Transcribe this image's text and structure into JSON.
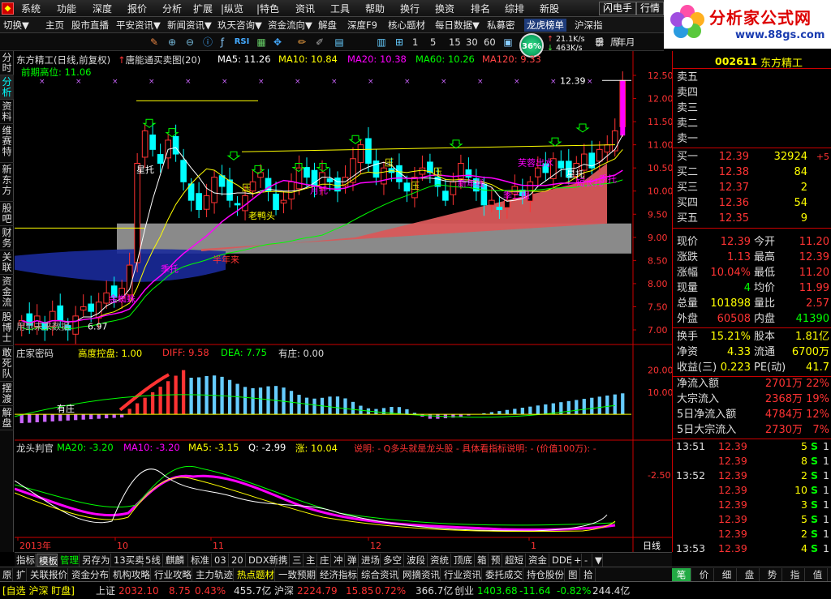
{
  "menubar": {
    "items": [
      "系统",
      "功能",
      "深度",
      "报价",
      "分析",
      "扩展",
      "|纵览",
      "|特色",
      "资讯",
      "工具",
      "帮助",
      "换行",
      "换资",
      "排名",
      "综排",
      "新股"
    ],
    "right_buttons": [
      "闪电手",
      "行情"
    ]
  },
  "logo": {
    "title": "分析家公式网",
    "url_text": "www.88gs.com"
  },
  "toolbar": {
    "items": [
      "切换▼",
      "主页",
      "股市直播",
      "平安资讯▼",
      "新闻资讯▼",
      "玖天咨询▼",
      "资金流向▼",
      "解盘",
      "深度F9",
      "核心题材",
      "每日数据▼",
      "私募密",
      "龙虎榜单",
      "沪深指"
    ]
  },
  "toolbar2": {
    "icons": [
      "pen-icon",
      "zoom-in-icon",
      "zoom-out-icon",
      "info-icon",
      "fx-icon",
      "rsi-icon",
      "grid-icon",
      "move-icon",
      "pencil-icon",
      "edit-icon",
      "chart-mini-icon"
    ],
    "rsi_label": "RSI",
    "periods": [
      "1",
      "5",
      "15",
      "30",
      "60"
    ],
    "gauge": "36%",
    "net_up": "21.1K/s",
    "net_down": "463K/s",
    "period_labels": [
      "日",
      "周",
      "月",
      "季",
      "年"
    ]
  },
  "left_tabs": [
    "分时",
    "分析",
    "资料",
    "维赛特",
    "新东方",
    "股吧",
    "财务",
    "关联",
    "资金流",
    "股博士",
    "敢死队",
    "摆渡",
    "解盘"
  ],
  "chart": {
    "main_header": {
      "title": "东方精工(日线,前复权)",
      "indicator": "唐能通买卖图(20)",
      "ma5": "MA5: 11.26",
      "ma10": "MA10: 10.84",
      "ma20": "MA20: 10.38",
      "ma60": "MA60: 10.26",
      "ma120": "MA120: 9.33",
      "prev_high": "前期高位: 11.06"
    },
    "price_axis": [
      "12.50",
      "12.00",
      "11.50",
      "11.00",
      "10.50",
      "10.00",
      "9.50",
      "9.00",
      "8.50",
      "8.00",
      "7.50",
      "7.00"
    ],
    "annotations": {
      "high_value": "12.39",
      "low_value": "6.97",
      "future_data": "用到未来数据",
      "labels": [
        "星托",
        "压",
        "压",
        "月托",
        "老鸭头",
        "季托",
        "半年来",
        "金蜘蛛",
        "压",
        "新年线",
        "芙蓉出水",
        "星托",
        "短长托",
        "季三组",
        "季托",
        "压"
      ]
    },
    "ind1_header": {
      "name": "庄家密码",
      "control": "高度控盘: 1.00",
      "diff": "DIFF: 9.58",
      "dea": "DEA: 7.75",
      "zhuang": "有庄: 0.00"
    },
    "ind1_axis": [
      "20.00",
      "10.00"
    ],
    "ind1_label": "有庄",
    "ind2_header": {
      "name": "龙头判官",
      "ma20": "MA20: -3.20",
      "ma10": "MA10: -3.20",
      "ma5": "MA5: -3.15",
      "q": "Q: -2.99",
      "zhang": "涨: 10.04",
      "note": "说明: - Q多头就是龙头股 - 具体看指标说明: - (价值100万): -"
    },
    "ind2_axis": [
      "-2.50"
    ],
    "date_axis": [
      "2013年",
      "10",
      "11",
      "12",
      "1"
    ],
    "period": "日线"
  },
  "quote": {
    "code": "002611",
    "name": "东方精工",
    "sell": [
      {
        "label": "卖五",
        "price": "",
        "vol": "",
        "chg": ""
      },
      {
        "label": "卖四",
        "price": "",
        "vol": "",
        "chg": ""
      },
      {
        "label": "卖三",
        "price": "",
        "vol": "",
        "chg": ""
      },
      {
        "label": "卖二",
        "price": "",
        "vol": "",
        "chg": ""
      },
      {
        "label": "卖一",
        "price": "",
        "vol": "",
        "chg": ""
      }
    ],
    "buy": [
      {
        "label": "买一",
        "price": "12.39",
        "vol": "32924",
        "chg": "+5"
      },
      {
        "label": "买二",
        "price": "12.38",
        "vol": "84",
        "chg": ""
      },
      {
        "label": "买三",
        "price": "12.37",
        "vol": "2",
        "chg": ""
      },
      {
        "label": "买四",
        "price": "12.36",
        "vol": "54",
        "chg": ""
      },
      {
        "label": "买五",
        "price": "12.35",
        "vol": "9",
        "chg": ""
      }
    ],
    "stats": [
      {
        "l1": "现价",
        "v1": "12.39",
        "l2": "今开",
        "v2": "11.20",
        "c1": "red",
        "c2": "red"
      },
      {
        "l1": "涨跌",
        "v1": "1.13",
        "l2": "最高",
        "v2": "12.39",
        "c1": "red",
        "c2": "red"
      },
      {
        "l1": "涨幅",
        "v1": "10.04%",
        "l2": "最低",
        "v2": "11.20",
        "c1": "red",
        "c2": "red"
      },
      {
        "l1": "现量",
        "v1": "4",
        "l2": "均价",
        "v2": "11.99",
        "c1": "green",
        "c2": "red"
      },
      {
        "l1": "总量",
        "v1": "101898",
        "l2": "量比",
        "v2": "2.57",
        "c1": "yellow",
        "c2": "red"
      },
      {
        "l1": "外盘",
        "v1": "60508",
        "l2": "内盘",
        "v2": "41390",
        "c1": "red",
        "c2": "green"
      }
    ],
    "stats2": [
      {
        "l1": "换手",
        "v1": "15.21%",
        "l2": "股本",
        "v2": "1.81亿"
      },
      {
        "l1": "净资",
        "v1": "4.33",
        "l2": "流通",
        "v2": "6700万"
      },
      {
        "l1": "收益(三)",
        "v1": "0.223",
        "l2": "PE(动)",
        "v2": "41.7"
      }
    ],
    "flows": [
      {
        "l": "净流入额",
        "v": "2701万",
        "pc": "22%"
      },
      {
        "l": "大宗流入",
        "v": "2368万",
        "pc": "19%"
      },
      {
        "l": "5日净流入额",
        "v": "4784万",
        "pc": "12%"
      },
      {
        "l": "5日大宗流入",
        "v": "2730万",
        "pc": "7%"
      }
    ],
    "ticks": [
      {
        "t": "13:51",
        "p": "12.39",
        "v": "5",
        "s": "S",
        "n": "1"
      },
      {
        "t": "",
        "p": "12.39",
        "v": "8",
        "s": "S",
        "n": "1"
      },
      {
        "t": "13:52",
        "p": "12.39",
        "v": "2",
        "s": "S",
        "n": "1"
      },
      {
        "t": "",
        "p": "12.39",
        "v": "10",
        "s": "S",
        "n": "1"
      },
      {
        "t": "",
        "p": "12.39",
        "v": "3",
        "s": "S",
        "n": "1"
      },
      {
        "t": "",
        "p": "12.39",
        "v": "5",
        "s": "S",
        "n": "1"
      },
      {
        "t": "",
        "p": "12.39",
        "v": "2",
        "s": "S",
        "n": "1"
      },
      {
        "t": "13:53",
        "p": "12.39",
        "v": "4",
        "s": "S",
        "n": "1"
      }
    ]
  },
  "indicator_tabs": [
    "指标",
    "模板",
    "管理",
    "另存为",
    "13买卖",
    "5线",
    "麒麟",
    "标准",
    "03",
    "20",
    "DDX新",
    "携",
    "三",
    "主",
    "庄",
    "冲",
    "弹",
    "进场",
    "多空",
    "波段",
    "资统",
    "顶底",
    "箱",
    "预",
    "超短",
    "资金",
    "DDE",
    "+",
    "-",
    "▼"
  ],
  "right_tabs": [
    "笔",
    "价",
    "细",
    "盘",
    "势",
    "指",
    "值"
  ],
  "news_tabs": [
    "原",
    "扩",
    "关联报价",
    "资金分布",
    "机构攻略",
    "行业攻略",
    "主力轨迹",
    "热点题材",
    "一致预期",
    "经济指标",
    "综合资讯",
    "网摘资讯",
    "行业资讯",
    "委托成交",
    "持仓股份",
    "图",
    "拾"
  ],
  "status": {
    "market": "[自选 沪深 盯盘]",
    "sh_name": "上证",
    "sh_val": "2032.10",
    "sh_chg": "8.75",
    "sh_pct": "0.43%",
    "sh_amt": "455.7亿",
    "hs_name": "沪深",
    "hs_val": "2224.79",
    "hs_chg": "15.85",
    "hs_pct": "0.72%",
    "hs_amt": "366.7亿",
    "cy_name": "创业",
    "cy_val": "1403.68",
    "cy_chg": "-11.64",
    "cy_pct": "-0.82%",
    "cy_amt": "244.4亿"
  },
  "colors": {
    "up": "#ff3333",
    "down": "#00ffff",
    "ma5": "#ffffff",
    "ma10": "#ffff00",
    "ma20": "#ff00ff",
    "ma60": "#00ff00",
    "ma120": "#ff4444",
    "border": "#c00000"
  }
}
